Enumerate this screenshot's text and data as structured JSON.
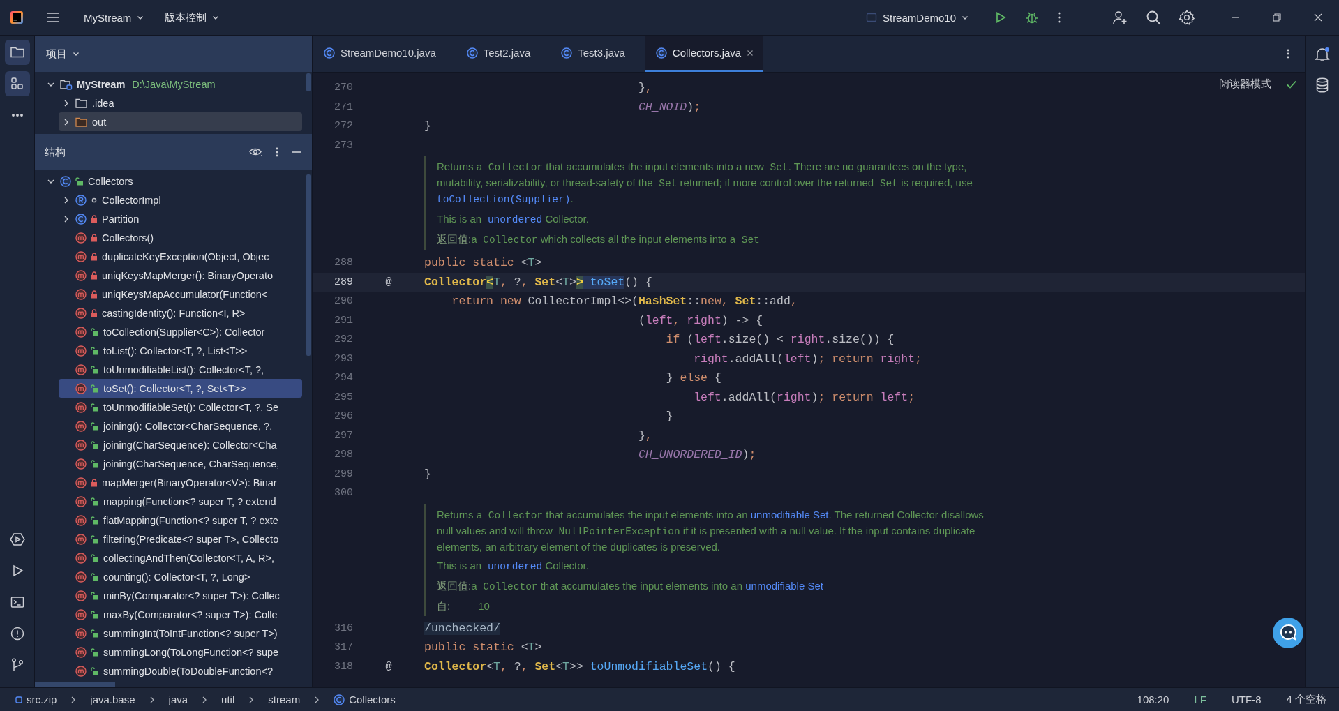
{
  "title_bar": {
    "project": "MyStream",
    "vcs": "版本控制",
    "run_config": "StreamDemo10"
  },
  "tool_windows": [
    {
      "kind": "project",
      "selected": true
    },
    {
      "kind": "structure",
      "selected": true
    },
    {
      "kind": "more",
      "selected": false
    }
  ],
  "tool_windows_bottom": [
    {
      "kind": "services",
      "selected": false
    },
    {
      "kind": "run",
      "selected": false
    },
    {
      "kind": "terminal",
      "selected": false
    },
    {
      "kind": "problems",
      "selected": false
    },
    {
      "kind": "git",
      "selected": false
    }
  ],
  "project_panel": {
    "title": "项目",
    "tree": [
      {
        "label": "MyStream",
        "location": "D:\\Java\\MyStream",
        "kind": "module",
        "expanded": true,
        "selected": false,
        "children": [
          {
            "label": ".idea",
            "kind": "folder",
            "expanded": false,
            "selected": false
          },
          {
            "label": "out",
            "kind": "output-folder",
            "expanded": false,
            "selected": true
          }
        ]
      }
    ]
  },
  "structure_panel": {
    "title": "结构",
    "tree": [
      {
        "label": "Collectors",
        "kind": "class",
        "modifier": {
          "kind": "public"
        },
        "expanded": true,
        "selected": false,
        "children": [
          {
            "label": "CollectorImpl",
            "kind": "record",
            "modifier": {
              "kind": "package"
            },
            "expanded": false,
            "selected": false
          },
          {
            "label": "Partition",
            "kind": "class",
            "modifier": {
              "kind": "private"
            },
            "expanded": false,
            "selected": false
          },
          {
            "label": "Collectors()",
            "kind": "method",
            "modifier": {
              "kind": "private"
            },
            "selected": false
          },
          {
            "label": "duplicateKeyException(Object, Objec",
            "kind": "method",
            "modifier": {
              "kind": "private"
            },
            "selected": false
          },
          {
            "label": "uniqKeysMapMerger(): BinaryOperato",
            "kind": "method",
            "modifier": {
              "kind": "private"
            },
            "selected": false
          },
          {
            "label": "uniqKeysMapAccumulator(Function<",
            "kind": "method",
            "modifier": {
              "kind": "private"
            },
            "selected": false
          },
          {
            "label": "castingIdentity(): Function<I, R>",
            "kind": "method",
            "modifier": {
              "kind": "private"
            },
            "selected": false
          },
          {
            "label": "toCollection(Supplier<C>): Collector",
            "kind": "method",
            "modifier": {
              "kind": "public"
            },
            "selected": false
          },
          {
            "label": "toList(): Collector<T, ?, List<T>>",
            "kind": "method",
            "modifier": {
              "kind": "public"
            },
            "selected": false
          },
          {
            "label": "toUnmodifiableList(): Collector<T, ?,",
            "kind": "method",
            "modifier": {
              "kind": "public"
            },
            "selected": false
          },
          {
            "label": "toSet(): Collector<T, ?, Set<T>>",
            "kind": "method",
            "modifier": {
              "kind": "public"
            },
            "selected": true
          },
          {
            "label": "toUnmodifiableSet(): Collector<T, ?, Se",
            "kind": "method",
            "modifier": {
              "kind": "public"
            },
            "selected": false
          },
          {
            "label": "joining(): Collector<CharSequence, ?,",
            "kind": "method",
            "modifier": {
              "kind": "public"
            },
            "selected": false
          },
          {
            "label": "joining(CharSequence): Collector<Cha",
            "kind": "method",
            "modifier": {
              "kind": "public"
            },
            "selected": false
          },
          {
            "label": "joining(CharSequence, CharSequence,",
            "kind": "method",
            "modifier": {
              "kind": "public"
            },
            "selected": false
          },
          {
            "label": "mapMerger(BinaryOperator<V>): Binar",
            "kind": "method",
            "modifier": {
              "kind": "private"
            },
            "selected": false
          },
          {
            "label": "mapping(Function<? super T, ? extend",
            "kind": "method",
            "modifier": {
              "kind": "public"
            },
            "selected": false
          },
          {
            "label": "flatMapping(Function<? super T, ? exte",
            "kind": "method",
            "modifier": {
              "kind": "public"
            },
            "selected": false
          },
          {
            "label": "filtering(Predicate<? super T>, Collecto",
            "kind": "method",
            "modifier": {
              "kind": "public"
            },
            "selected": false
          },
          {
            "label": "collectingAndThen(Collector<T, A, R>,",
            "kind": "method",
            "modifier": {
              "kind": "public"
            },
            "selected": false
          },
          {
            "label": "counting(): Collector<T, ?, Long>",
            "kind": "method",
            "modifier": {
              "kind": "public"
            },
            "selected": false
          },
          {
            "label": "minBy(Comparator<? super T>): Collec",
            "kind": "method",
            "modifier": {
              "kind": "public"
            },
            "selected": false
          },
          {
            "label": "maxBy(Comparator<? super T>): Colle",
            "kind": "method",
            "modifier": {
              "kind": "public"
            },
            "selected": false
          },
          {
            "label": "summingInt(ToIntFunction<? super T>)",
            "kind": "method",
            "modifier": {
              "kind": "public"
            },
            "selected": false
          },
          {
            "label": "summingLong(ToLongFunction<? supe",
            "kind": "method",
            "modifier": {
              "kind": "public"
            },
            "selected": false
          },
          {
            "label": "summingDouble(ToDoubleFunction<?",
            "kind": "method",
            "modifier": {
              "kind": "public"
            },
            "selected": false
          }
        ]
      }
    ]
  },
  "tabs": [
    {
      "label": "StreamDemo10.java",
      "selected": false
    },
    {
      "label": "Test2.java",
      "selected": false
    },
    {
      "label": "Test3.java",
      "selected": false
    },
    {
      "label": "Collectors.java",
      "selected": true
    }
  ],
  "editor": {
    "reader_mode": "阅读器模式",
    "lines": [
      {
        "kind": "code",
        "number": "270",
        "current": false,
        "tokens": [
          {
            "t": "                               }",
            "kind": "plain"
          },
          {
            "t": ",",
            "kind": "punct"
          }
        ]
      },
      {
        "kind": "code",
        "number": "271",
        "current": false,
        "tokens": [
          {
            "t": "                               CH_NOID",
            "kind": "const"
          },
          {
            "t": ")",
            "kind": "plain"
          },
          {
            "t": ";",
            "kind": "punct"
          }
        ]
      },
      {
        "kind": "code",
        "number": "272",
        "current": false,
        "tokens": [
          {
            "t": "}",
            "kind": "plain"
          }
        ]
      },
      {
        "kind": "code",
        "number": "273",
        "current": false
      },
      {
        "kind": "doc",
        "paragraphs": [
          {
            "kind": "text",
            "segments": [
              {
                "t": "Returns a",
                "kind": "text"
              },
              {
                "t": " Collector",
                "kind": "code"
              },
              {
                "t": " that accumulates the input elements into a new",
                "kind": "text"
              },
              {
                "t": " Set",
                "kind": "code"
              },
              {
                "t": ". There are no guarantees on the type, mutability, serializability, or thread-safety of the",
                "kind": "text"
              },
              {
                "t": " Set",
                "kind": "code"
              },
              {
                "t": " returned; if more control over the returned",
                "kind": "text"
              },
              {
                "t": " Set",
                "kind": "code"
              },
              {
                "t": " is required, use",
                "kind": "text"
              },
              {
                "t": " toCollection(Supplier)",
                "kind": "code-link"
              },
              {
                "t": ".",
                "kind": "text"
              }
            ]
          },
          {
            "kind": "text",
            "segments": [
              {
                "t": "This is an",
                "kind": "text"
              },
              {
                "t": " unordered",
                "kind": "code-link"
              },
              {
                "t": " Collector.",
                "kind": "text"
              }
            ]
          },
          {
            "kind": "returns",
            "label": "返回值:",
            "segments": [
              {
                "t": "a",
                "kind": "text"
              },
              {
                "t": " Collector",
                "kind": "code"
              },
              {
                "t": " which collects all the input elements into a",
                "kind": "text"
              },
              {
                "t": " Set",
                "kind": "code"
              }
            ]
          }
        ]
      },
      {
        "kind": "code",
        "number": "288",
        "current": false,
        "tokens": [
          {
            "t": "public static",
            "kind": "kw"
          },
          {
            "t": " <",
            "kind": "plain"
          },
          {
            "t": "T",
            "kind": "tparam"
          },
          {
            "t": ">",
            "kind": "plain"
          }
        ]
      },
      {
        "kind": "code",
        "number": "289",
        "current": true,
        "marker": "@",
        "tokens": [
          {
            "t": "Collector",
            "kind": "type"
          },
          {
            "t": "<",
            "kind": "match"
          },
          {
            "t": "T",
            "kind": "tparam"
          },
          {
            "t": ",",
            "kind": "punct"
          },
          {
            "t": " ?",
            "kind": "plain"
          },
          {
            "t": ",",
            "kind": "punct"
          },
          {
            "t": " Set",
            "kind": "type"
          },
          {
            "t": "<",
            "kind": "plain"
          },
          {
            "t": "T",
            "kind": "tparam"
          },
          {
            "t": ">",
            "kind": "plain"
          },
          {
            "t": ">",
            "kind": "match"
          },
          {
            "t": " toSet",
            "kind": "usage"
          },
          {
            "t": "() {",
            "kind": "plain"
          }
        ]
      },
      {
        "kind": "code",
        "number": "290",
        "current": false,
        "tokens": [
          {
            "t": "    return new",
            "kind": "kw"
          },
          {
            "t": " CollectorImpl<>(",
            "kind": "plain"
          },
          {
            "t": "HashSet",
            "kind": "type"
          },
          {
            "t": "::",
            "kind": "plain"
          },
          {
            "t": "new",
            "kind": "kw"
          },
          {
            "t": ",",
            "kind": "punct"
          },
          {
            "t": " Set",
            "kind": "type"
          },
          {
            "t": "::add",
            "kind": "plain"
          },
          {
            "t": ",",
            "kind": "punct"
          }
        ]
      },
      {
        "kind": "code",
        "number": "291",
        "current": false,
        "tokens": [
          {
            "t": "                               (",
            "kind": "plain"
          },
          {
            "t": "left",
            "kind": "param"
          },
          {
            "t": ",",
            "kind": "punct"
          },
          {
            "t": " right",
            "kind": "param"
          },
          {
            "t": ") -> {",
            "kind": "plain"
          }
        ]
      },
      {
        "kind": "code",
        "number": "292",
        "current": false,
        "tokens": [
          {
            "t": "                                   if",
            "kind": "kw"
          },
          {
            "t": " (",
            "kind": "plain"
          },
          {
            "t": "left",
            "kind": "param"
          },
          {
            "t": ".size() < ",
            "kind": "plain"
          },
          {
            "t": "right",
            "kind": "param"
          },
          {
            "t": ".size()) {",
            "kind": "plain"
          }
        ]
      },
      {
        "kind": "code",
        "number": "293",
        "current": false,
        "tokens": [
          {
            "t": "                                       right",
            "kind": "param"
          },
          {
            "t": ".addAll(",
            "kind": "plain"
          },
          {
            "t": "left",
            "kind": "param"
          },
          {
            "t": ")",
            "kind": "plain"
          },
          {
            "t": ";",
            "kind": "punct"
          },
          {
            "t": " return",
            "kind": "kw"
          },
          {
            "t": " right",
            "kind": "param"
          },
          {
            "t": ";",
            "kind": "punct"
          }
        ]
      },
      {
        "kind": "code",
        "number": "294",
        "current": false,
        "tokens": [
          {
            "t": "                                   } ",
            "kind": "plain"
          },
          {
            "t": "else",
            "kind": "kw"
          },
          {
            "t": " {",
            "kind": "plain"
          }
        ]
      },
      {
        "kind": "code",
        "number": "295",
        "current": false,
        "tokens": [
          {
            "t": "                                       left",
            "kind": "param"
          },
          {
            "t": ".addAll(",
            "kind": "plain"
          },
          {
            "t": "right",
            "kind": "param"
          },
          {
            "t": ")",
            "kind": "plain"
          },
          {
            "t": ";",
            "kind": "punct"
          },
          {
            "t": " return",
            "kind": "kw"
          },
          {
            "t": " left",
            "kind": "param"
          },
          {
            "t": ";",
            "kind": "punct"
          }
        ]
      },
      {
        "kind": "code",
        "number": "296",
        "current": false,
        "tokens": [
          {
            "t": "                                   }",
            "kind": "plain"
          }
        ]
      },
      {
        "kind": "code",
        "number": "297",
        "current": false,
        "tokens": [
          {
            "t": "                               }",
            "kind": "plain"
          },
          {
            "t": ",",
            "kind": "punct"
          }
        ]
      },
      {
        "kind": "code",
        "number": "298",
        "current": false,
        "tokens": [
          {
            "t": "                               CH_UNORDERED_ID",
            "kind": "const"
          },
          {
            "t": ")",
            "kind": "plain"
          },
          {
            "t": ";",
            "kind": "punct"
          }
        ]
      },
      {
        "kind": "code",
        "number": "299",
        "current": false,
        "tokens": [
          {
            "t": "}",
            "kind": "plain"
          }
        ]
      },
      {
        "kind": "code",
        "number": "300",
        "current": false
      },
      {
        "kind": "doc",
        "paragraphs": [
          {
            "kind": "text",
            "segments": [
              {
                "t": "Returns a",
                "kind": "text"
              },
              {
                "t": " Collector",
                "kind": "code"
              },
              {
                "t": " that accumulates the input elements into an",
                "kind": "text"
              },
              {
                "t": " unmodifiable Set",
                "kind": "link"
              },
              {
                "t": ". The returned Collector disallows null values and will throw",
                "kind": "text"
              },
              {
                "t": " NullPointerException",
                "kind": "code"
              },
              {
                "t": " if it is presented with a null value. If the input contains duplicate elements, an arbitrary element of the duplicates is preserved.",
                "kind": "text"
              }
            ]
          },
          {
            "kind": "text",
            "segments": [
              {
                "t": "This is an",
                "kind": "text"
              },
              {
                "t": " unordered",
                "kind": "code-link"
              },
              {
                "t": " Collector.",
                "kind": "text"
              }
            ]
          },
          {
            "kind": "returns",
            "label": "返回值:",
            "segments": [
              {
                "t": "a",
                "kind": "text"
              },
              {
                "t": " Collector",
                "kind": "code"
              },
              {
                "t": " that accumulates the input elements into an",
                "kind": "text"
              },
              {
                "t": " unmodifiable Set",
                "kind": "link"
              }
            ]
          },
          {
            "kind": "since",
            "label": "自:",
            "value": "10"
          }
        ]
      },
      {
        "kind": "code",
        "number": "316",
        "current": false,
        "tokens": [
          {
            "t": "/unchecked/",
            "kind": "box"
          }
        ]
      },
      {
        "kind": "code",
        "number": "317",
        "current": false,
        "tokens": [
          {
            "t": "public static",
            "kind": "kw"
          },
          {
            "t": " <",
            "kind": "plain"
          },
          {
            "t": "T",
            "kind": "tparam"
          },
          {
            "t": ">",
            "kind": "plain"
          }
        ]
      },
      {
        "kind": "code",
        "number": "318",
        "current": false,
        "marker": "@",
        "tokens": [
          {
            "t": "Collector",
            "kind": "type"
          },
          {
            "t": "<",
            "kind": "plain"
          },
          {
            "t": "T",
            "kind": "tparam"
          },
          {
            "t": ",",
            "kind": "punct"
          },
          {
            "t": " ?",
            "kind": "plain"
          },
          {
            "t": ",",
            "kind": "punct"
          },
          {
            "t": " Set",
            "kind": "type"
          },
          {
            "t": "<",
            "kind": "plain"
          },
          {
            "t": "T",
            "kind": "tparam"
          },
          {
            "t": ">> ",
            "kind": "plain"
          },
          {
            "t": "toUnmodifiableSet",
            "kind": "method"
          },
          {
            "t": "() {",
            "kind": "plain"
          }
        ]
      }
    ]
  },
  "breadcrumbs": [
    {
      "label": "src.zip",
      "kind": "archive"
    },
    {
      "label": "java.base",
      "kind": "package"
    },
    {
      "label": "java",
      "kind": "package"
    },
    {
      "label": "util",
      "kind": "package"
    },
    {
      "label": "stream",
      "kind": "package"
    },
    {
      "label": "Collectors",
      "kind": "class"
    }
  ],
  "status": {
    "position": "108:20",
    "line_ending": "LF",
    "encoding": "UTF-8",
    "indent": "4 个空格"
  }
}
